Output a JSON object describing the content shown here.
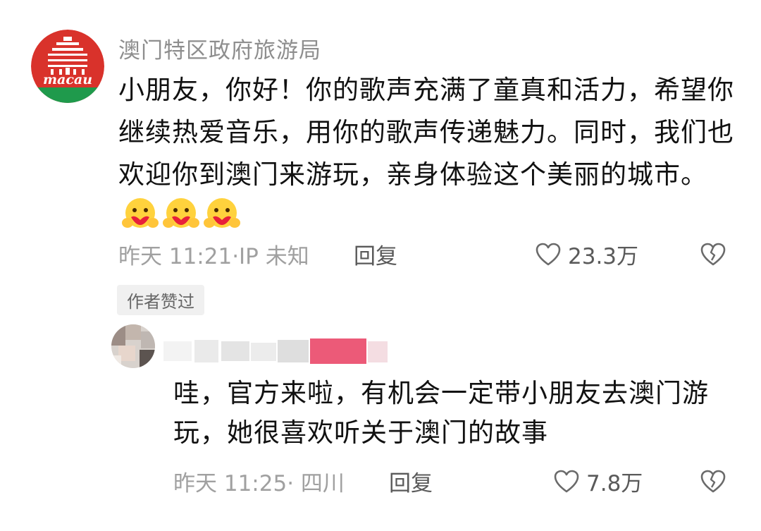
{
  "comment": {
    "username": "澳门特区政府旅游局",
    "avatar_logo_text": "macau",
    "text": "小朋友，你好！你的歌声充满了童真和活力，希望你继续热爱音乐，用你的歌声传递魅力。同时，我们也欢迎你到澳门来游玩，亲身体验这个美丽的城市。",
    "emojis": [
      "hugging-heart-emoji",
      "hugging-heart-emoji",
      "hugging-heart-emoji"
    ],
    "time_location": "昨天 11:21·IP 未知",
    "reply_label": "回复",
    "like_count": "23.3万",
    "author_badge": "作者赞过"
  },
  "reply": {
    "username": "",
    "text": "哇，官方来啦，有机会一定带小朋友去澳门游玩，她很喜欢听关于澳门的故事",
    "time_location": "昨天 11:25· 四川",
    "reply_label": "回复",
    "like_count": "7.8万"
  },
  "colors": {
    "logo_red": "#d9322b",
    "logo_green": "#1f9a4c",
    "meta_gray": "#a0a0a0",
    "blur_pink": "#ec5a78"
  }
}
